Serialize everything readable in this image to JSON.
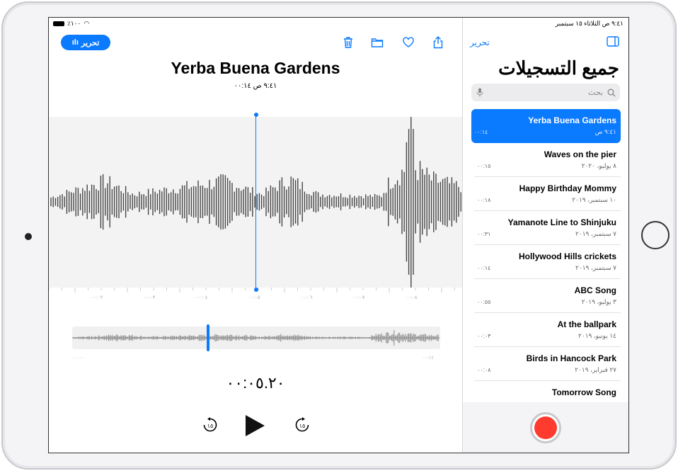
{
  "status_bar": {
    "time_date": "٩:٤١ ص   الثلاثاء ١٥ سبتمبر",
    "battery": "٪١٠٠"
  },
  "detail": {
    "edit_label": "تحرير",
    "title": "Yerba Buena Gardens",
    "subtitle": "٩:٤١ ص  ٠٠:١٤",
    "ruler_ticks": [
      "٠٠:٠٢",
      "٠٠:٠٣",
      "٠٠:٠٤",
      "٠٠:٠٥",
      "٠٠:٠٦",
      "٠٠:٠٧",
      "٠٠:٠٨"
    ],
    "overview_start": "٠٠:٠٠",
    "overview_end": "٠٠:١٤",
    "playback_position": 0.37,
    "current_time": "٠٠:٠٥.٢٠",
    "skip_back_label": "١٥",
    "skip_forward_label": "١٥",
    "toolbar_icons": [
      "trash-icon",
      "folder-icon",
      "heart-icon",
      "share-icon"
    ],
    "accent": "#0a7aff"
  },
  "sidebar": {
    "edit_label": "تحرير",
    "title": "جميع التسجيلات",
    "search_placeholder": "بحث",
    "recordings": [
      {
        "name": "Yerba Buena Gardens",
        "date": "٩:٤١ ص",
        "duration": "٠٠:١٤"
      },
      {
        "name": "Waves on the pier",
        "date": "٨ يوليو، ٢٠٢٠",
        "duration": "٠٠:١٥"
      },
      {
        "name": "Happy Birthday Mommy",
        "date": "١٠ سبتمبر، ٢٠١٩",
        "duration": "٠٠:١٨"
      },
      {
        "name": "Yamanote Line to Shinjuku",
        "date": "٧ سبتمبر، ٢٠١٩",
        "duration": "٠٠:٣١"
      },
      {
        "name": "Hollywood Hills crickets",
        "date": "٧ سبتمبر، ٢٠١٩",
        "duration": "٠٠:١٤"
      },
      {
        "name": "ABC Song",
        "date": "٣ يوليو، ٢٠١٩",
        "duration": "٠٠:٥٥"
      },
      {
        "name": "At the ballpark",
        "date": "١٤ يونيو، ٢٠١٩",
        "duration": "٠٠:٠٣"
      },
      {
        "name": "Birds in Hancock Park",
        "date": "٢٧ فبراير، ٢٠١٩",
        "duration": "٠٠:٠٨"
      },
      {
        "name": "Tomorrow Song",
        "date": "",
        "duration": ""
      }
    ],
    "record_color": "#ff3b30"
  }
}
